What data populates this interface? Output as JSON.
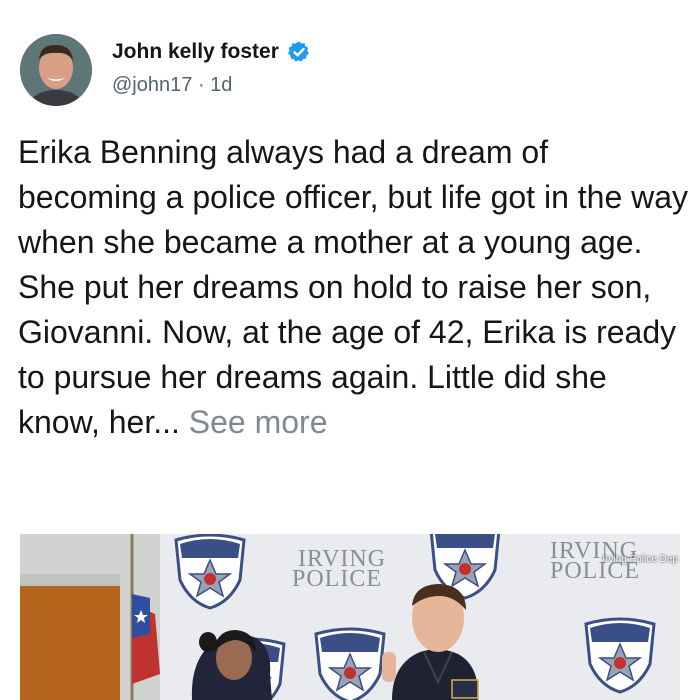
{
  "tweet": {
    "author_name": "John kelly foster",
    "handle": "@john17",
    "separator": "·",
    "time": "1d",
    "text": "Erika Benning always had a dream of becoming a police officer, but life got in the way when she became a mother at a young age. She put her dreams on hold to raise her son, Giovanni. Now, at the age of 42, Erika is ready to pursue her dreams again. Little did she know, her...",
    "see_more": "See more"
  },
  "icons": {
    "verified": "verified-badge-icon",
    "avatar": "avatar"
  },
  "photo": {
    "backdrop_text_1": "IRVING",
    "backdrop_text_2": "POLICE",
    "badge_text": "POLICE",
    "credit": "Irving Police Dep"
  },
  "colors": {
    "text": "#14171a",
    "secondary": "#536471",
    "see_more": "#7b8a95",
    "verified": "#1d9bf0"
  }
}
